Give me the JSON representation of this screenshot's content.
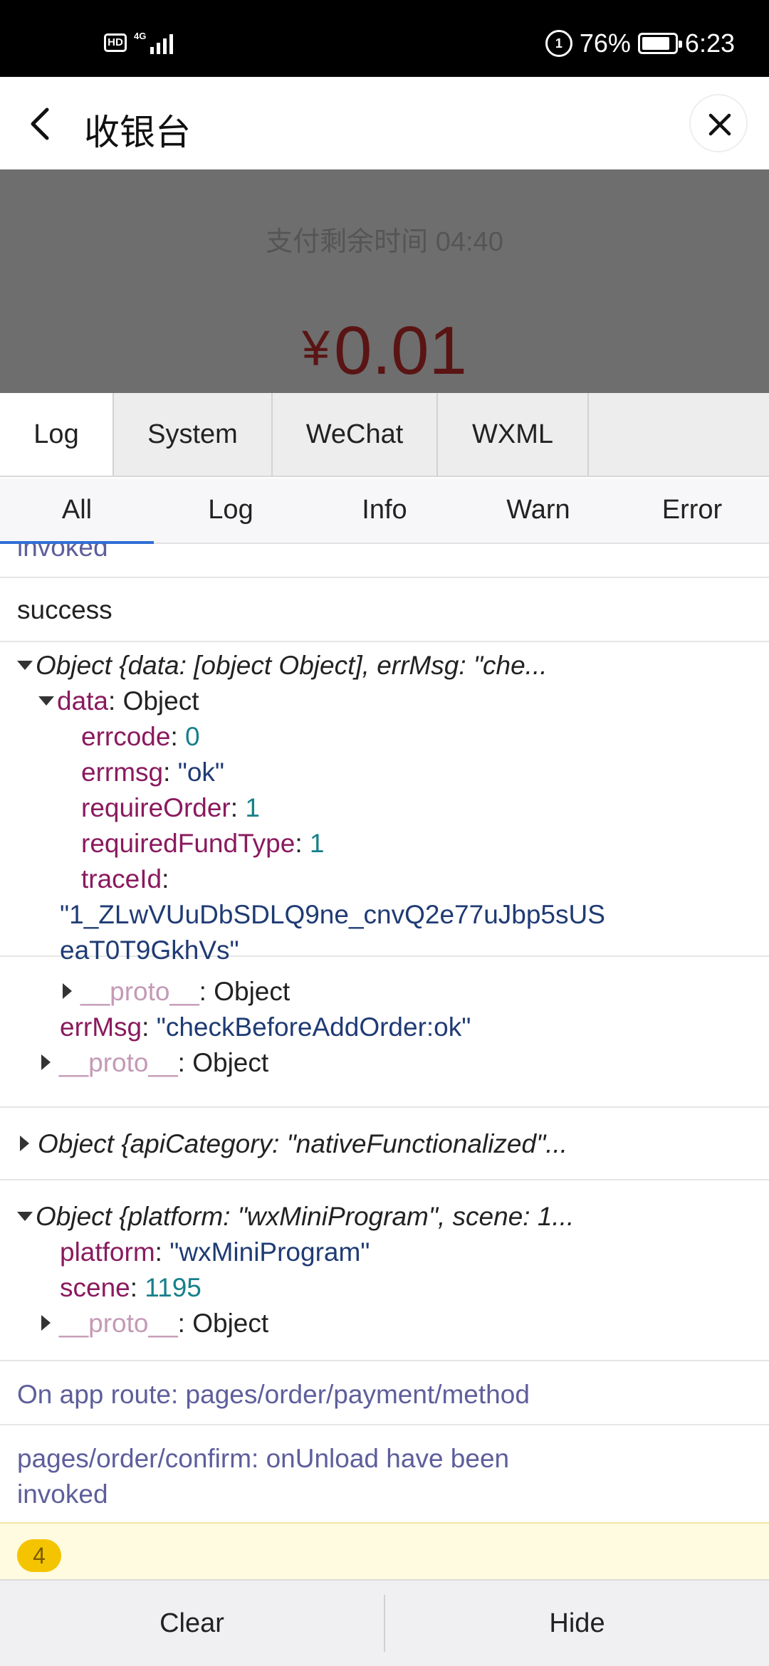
{
  "status_bar": {
    "hd": "HD",
    "network": "4G",
    "battery_percent": "76%",
    "time": "6:23"
  },
  "header": {
    "title": "收银台"
  },
  "payment": {
    "timer": "支付剩余时间 04:40",
    "currency": "¥",
    "amount": "0.01"
  },
  "tabs": [
    "Log",
    "System",
    "WeChat",
    "WXML"
  ],
  "filters": [
    "All",
    "Log",
    "Info",
    "Warn",
    "Error"
  ],
  "log": {
    "partial_top": "invoked",
    "success": "success",
    "obj1": {
      "summary": "Object {data: [object Object], errMsg: \"che...",
      "data_key": "data",
      "data_type": "Object",
      "errcode_key": "errcode",
      "errcode_val": "0",
      "errmsg_key": "errmsg",
      "errmsg_val": "\"ok\"",
      "requireOrder_key": "requireOrder",
      "requireOrder_val": "1",
      "requiredFundType_key": "requiredFundType",
      "requiredFundType_val": "1",
      "traceId_key": "traceId",
      "traceId_val_1": "\"1_ZLwVUuDbSDLQ9ne_cnvQ2e77uJbp5sUS",
      "traceId_val_2": "eaT0T9GkhVs\"",
      "proto_key": "__proto__",
      "proto_type": "Object",
      "errMsg_key": "errMsg",
      "errMsg_val": "\"checkBeforeAddOrder:ok\""
    },
    "obj2": {
      "summary": "Object {apiCategory: \"nativeFunctionalized\"..."
    },
    "obj3": {
      "summary": "Object {platform: \"wxMiniProgram\", scene: 1...",
      "platform_key": "platform",
      "platform_val": "\"wxMiniProgram\"",
      "scene_key": "scene",
      "scene_val": "1195",
      "proto_key": "__proto__",
      "proto_type": "Object"
    },
    "route": "On app route: pages/order/payment/method",
    "unload_1": "pages/order/confirm: onUnload have been",
    "unload_2": "invoked",
    "warn_count": "4"
  },
  "bottom": {
    "clear": "Clear",
    "hide": "Hide"
  },
  "colors": {
    "accent": "#2f6fd6",
    "amount": "#5a1414",
    "warn_bg": "#fffbe0",
    "badge": "#f5c400"
  }
}
